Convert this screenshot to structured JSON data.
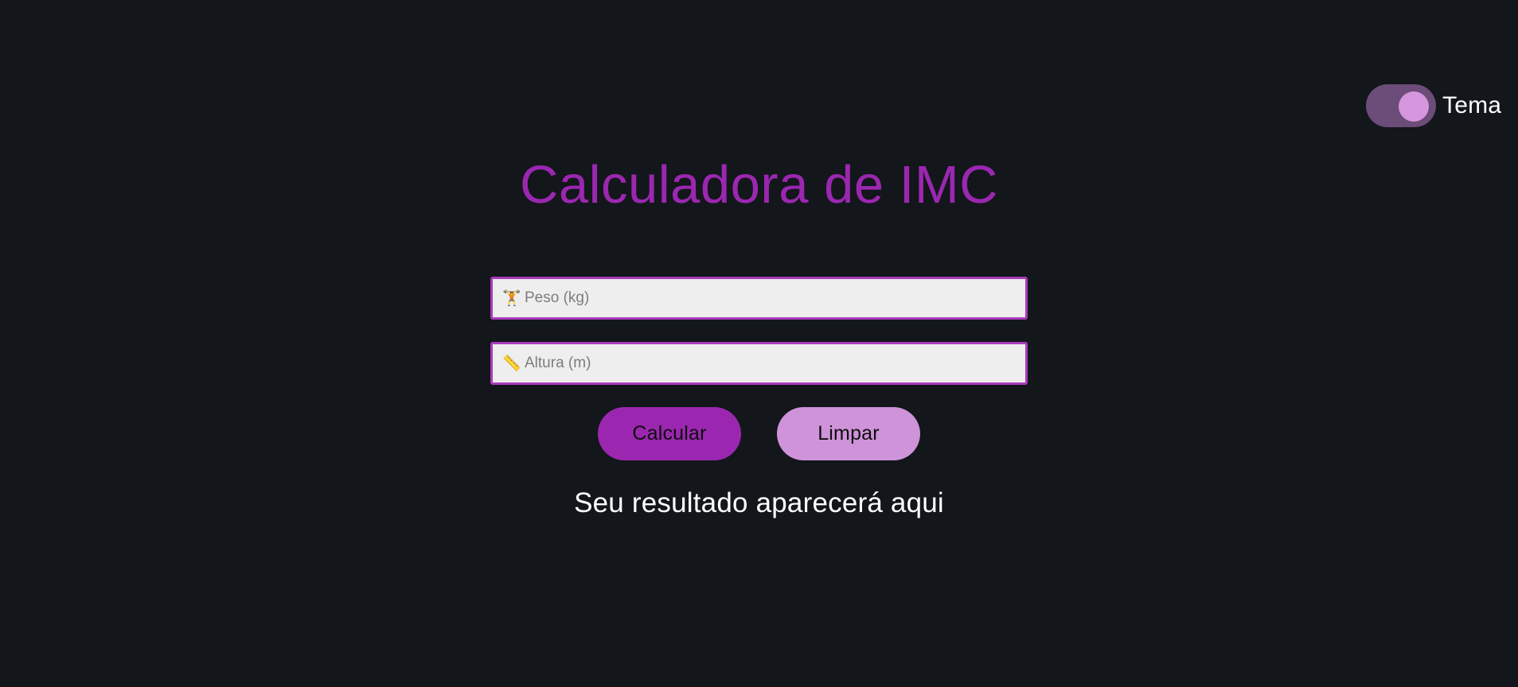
{
  "theme_toggle": {
    "label": "Tema",
    "state": "on",
    "track_color": "#6c4c78",
    "thumb_color": "#d596de"
  },
  "header": {
    "title": "Calculadora de IMC",
    "title_color": "#9b27b0"
  },
  "form": {
    "weight": {
      "icon": "🏋️",
      "icon_name": "weightlifter-icon",
      "placeholder": "Peso (kg)",
      "value": ""
    },
    "height": {
      "icon": "📏",
      "icon_name": "ruler-icon",
      "placeholder": "Altura (m)",
      "value": ""
    },
    "border_color": "#a83cba"
  },
  "actions": {
    "calculate_label": "Calcular",
    "calculate_color": "#9b27b0",
    "clear_label": "Limpar",
    "clear_color": "#cf93d9"
  },
  "result": {
    "text": "Seu resultado aparecerá aqui"
  },
  "colors": {
    "background": "#13161b",
    "text": "#ffffff"
  }
}
